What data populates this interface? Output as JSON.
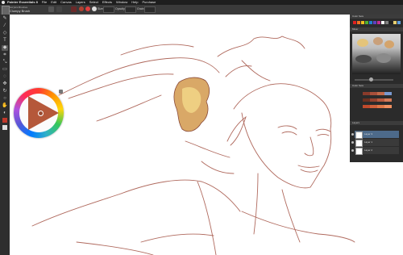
{
  "menubar": {
    "app": "Painter Essentials 8",
    "items": [
      "File",
      "Edit",
      "Canvas",
      "Layers",
      "Select",
      "Effects",
      "Window",
      "Help",
      "Purchase"
    ]
  },
  "brush": {
    "category": "Acrylics Brushes",
    "variant": "Clumpy Brush"
  },
  "propbar": {
    "size_label": "Size",
    "opacity_label": "Opacity",
    "grain_label": "Grain"
  },
  "panels": {
    "color_set_title": "Color Sets",
    "mixer_title": "Mixer",
    "layers_title": "Layers"
  },
  "layers": [
    {
      "name": "Layer 3"
    },
    {
      "name": "Layer 1"
    },
    {
      "name": "Layer 2"
    }
  ],
  "colors": {
    "stroke": "#b06a5e",
    "accent_orange": "#c46a3a",
    "swatches_top": [
      "#e02020",
      "#f07020",
      "#f0c020",
      "#50b030",
      "#2080d0",
      "#6040c0",
      "#c03090",
      "#ffffff",
      "#808080",
      "#202020",
      "#e8d070",
      "#60a0e0"
    ],
    "color_set_rows": [
      [
        "#8a3b2b",
        "#a8503a",
        "#c46a4a",
        "#7a9ad0"
      ],
      [
        "#6b3020",
        "#94422e",
        "#b85a3e",
        "#d47a58"
      ],
      [
        "#c04a2c",
        "#d0603a",
        "#e07848",
        "#f09060"
      ]
    ]
  }
}
